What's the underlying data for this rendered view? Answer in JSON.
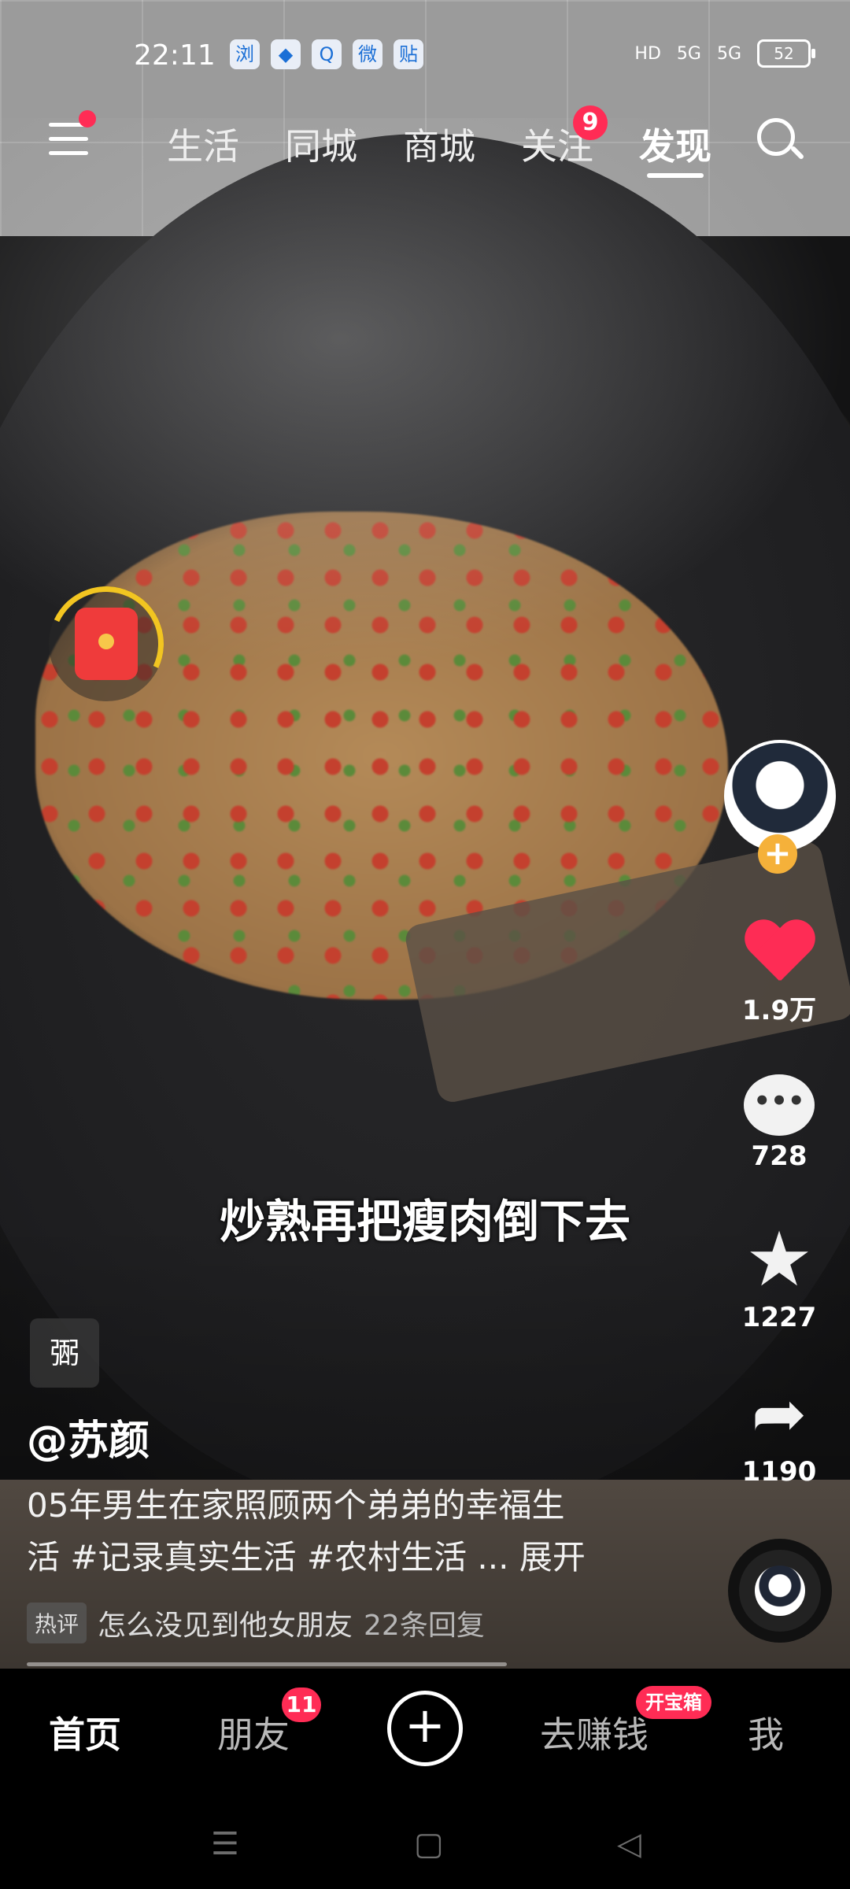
{
  "status": {
    "time": "22:11",
    "app_icons": [
      "浏",
      "◆",
      "Q",
      "微",
      "贴"
    ],
    "hd": "HD",
    "signal1": "5G",
    "signal2": "5G",
    "battery": "52"
  },
  "topnav": {
    "tabs": [
      "生活",
      "同城",
      "商城",
      "关注",
      "发现"
    ],
    "follow_badge": "9",
    "active_tab": "发现"
  },
  "video": {
    "subtitle": "炒熟再把瘦肉倒下去"
  },
  "side": {
    "likes": "1.9万",
    "comments": "728",
    "favorites": "1227",
    "shares": "1190",
    "comment_glyph": "•••"
  },
  "info": {
    "tag": "弻",
    "author": "@苏颜",
    "desc_line1": "05年男生在家照顾两个弟弟的幸福生",
    "desc_line2": "活 #记录真实生活 #农村生活 ... 展开",
    "hot_label": "热评",
    "hot_text": "怎么没见到他女朋友",
    "hot_reply": "22条回复"
  },
  "bottomnav": {
    "home": "首页",
    "friends": "朋友",
    "friends_badge": "11",
    "plus": "+",
    "earn": "去赚钱",
    "earn_badge": "开宝箱",
    "me": "我"
  },
  "sysnav": {
    "menu": "☰",
    "home": "▢",
    "back": "◁"
  }
}
